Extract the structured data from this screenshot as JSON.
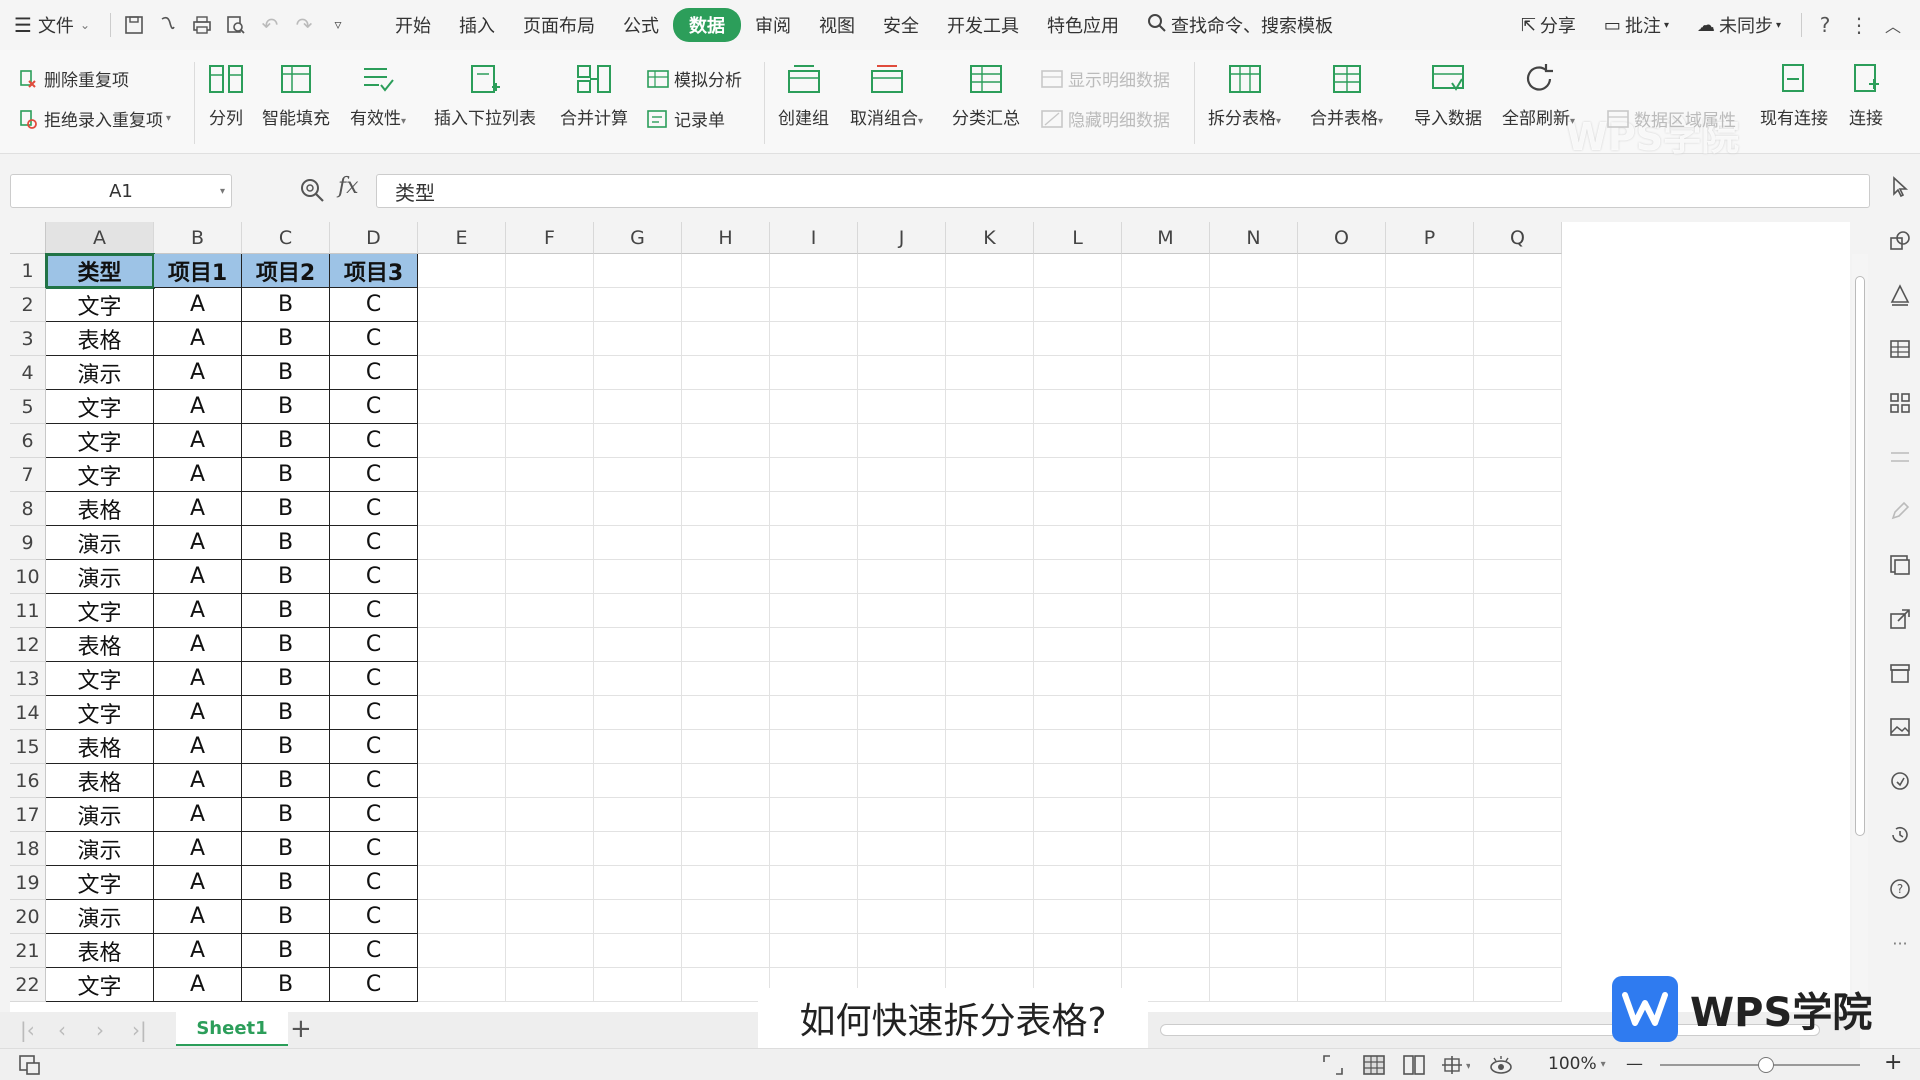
{
  "menubar": {
    "file_label": "文件",
    "tabs": [
      "开始",
      "插入",
      "页面布局",
      "公式",
      "数据",
      "审阅",
      "视图",
      "安全",
      "开发工具",
      "特色应用"
    ],
    "active_tab": "数据",
    "search_label": "查找命令、搜索模板",
    "share_label": "分享",
    "comment_label": "批注",
    "sync_label": "未同步",
    "help_label": "?"
  },
  "ribbon": {
    "delete_dup": "删除重复项",
    "reject_dup": "拒绝录入重复项",
    "split_col": "分列",
    "smart_fill": "智能填充",
    "validity": "有效性",
    "insert_dropdown": "插入下拉列表",
    "consolidate": "合并计算",
    "simulate": "模拟分析",
    "record_form": "记录单",
    "create_group": "创建组",
    "ungroup": "取消组合",
    "subtotal": "分类汇总",
    "show_detail": "显示明细数据",
    "hide_detail": "隐藏明细数据",
    "split_table": "拆分表格",
    "merge_table": "合并表格",
    "import_data": "导入数据",
    "refresh_all": "全部刷新",
    "range_props": "数据区域属性",
    "existing_conn": "现有连接",
    "connect": "连接"
  },
  "formula": {
    "cell_ref": "A1",
    "fx": "fx",
    "content": "类型"
  },
  "grid": {
    "columns": [
      "A",
      "B",
      "C",
      "D",
      "E",
      "F",
      "G",
      "H",
      "I",
      "J",
      "K",
      "L",
      "M",
      "N",
      "O",
      "P",
      "Q"
    ],
    "header_row": [
      "类型",
      "项目1",
      "项目2",
      "项目3"
    ],
    "rows": [
      [
        "文字",
        "A",
        "B",
        "C"
      ],
      [
        "表格",
        "A",
        "B",
        "C"
      ],
      [
        "演示",
        "A",
        "B",
        "C"
      ],
      [
        "文字",
        "A",
        "B",
        "C"
      ],
      [
        "文字",
        "A",
        "B",
        "C"
      ],
      [
        "文字",
        "A",
        "B",
        "C"
      ],
      [
        "表格",
        "A",
        "B",
        "C"
      ],
      [
        "演示",
        "A",
        "B",
        "C"
      ],
      [
        "演示",
        "A",
        "B",
        "C"
      ],
      [
        "文字",
        "A",
        "B",
        "C"
      ],
      [
        "表格",
        "A",
        "B",
        "C"
      ],
      [
        "文字",
        "A",
        "B",
        "C"
      ],
      [
        "文字",
        "A",
        "B",
        "C"
      ],
      [
        "表格",
        "A",
        "B",
        "C"
      ],
      [
        "表格",
        "A",
        "B",
        "C"
      ],
      [
        "演示",
        "A",
        "B",
        "C"
      ],
      [
        "演示",
        "A",
        "B",
        "C"
      ],
      [
        "文字",
        "A",
        "B",
        "C"
      ],
      [
        "演示",
        "A",
        "B",
        "C"
      ],
      [
        "表格",
        "A",
        "B",
        "C"
      ],
      [
        "文字",
        "A",
        "B",
        "C"
      ]
    ],
    "header_fill": "#9dc3e6"
  },
  "sheets": {
    "active": "Sheet1",
    "add": "+"
  },
  "status": {
    "zoom": "100%",
    "minus": "—",
    "plus": "+"
  },
  "overlay": {
    "subtitle": "如何快速拆分表格?",
    "logo_text": "WPS学院",
    "watermark": "WPS学院"
  },
  "colors": {
    "accent": "#2c9e5a",
    "logo_blue": "#2f7bf0"
  }
}
